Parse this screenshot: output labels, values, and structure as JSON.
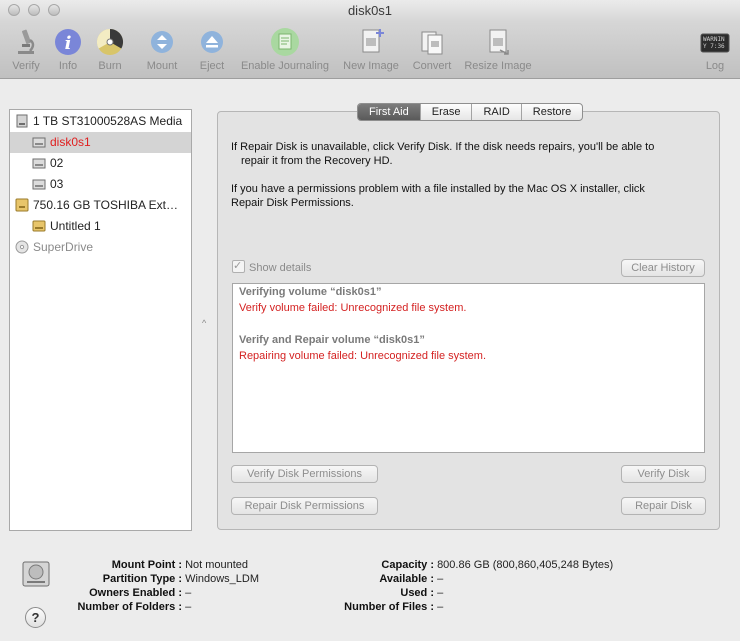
{
  "window": {
    "title": "disk0s1"
  },
  "toolbar": {
    "verify": "Verify",
    "info": "Info",
    "burn": "Burn",
    "mount": "Mount",
    "eject": "Eject",
    "enable_journaling": "Enable Journaling",
    "new_image": "New Image",
    "convert": "Convert",
    "resize_image": "Resize Image",
    "log": "Log",
    "log_icon_text_1": "WARNIN",
    "log_icon_text_2": "Y 7:36"
  },
  "sidebar": {
    "items": [
      {
        "label": "1 TB ST31000528AS Media",
        "selected": false
      },
      {
        "label": "disk0s1",
        "selected": true
      },
      {
        "label": "02",
        "selected": false
      },
      {
        "label": "03",
        "selected": false
      },
      {
        "label": "750.16 GB TOSHIBA Ext…",
        "selected": false
      },
      {
        "label": "Untitled 1",
        "selected": false
      },
      {
        "label": "SuperDrive",
        "selected": false
      }
    ]
  },
  "tabs": [
    "First Aid",
    "Erase",
    "RAID",
    "Restore"
  ],
  "active_tab": "First Aid",
  "first_aid": {
    "para1_line1": "If Repair Disk is unavailable, click Verify Disk. If the disk needs repairs, you'll be able to",
    "para1_line2": "repair it from the Recovery HD.",
    "para2_line1": "If you have a permissions problem with a file installed by the Mac OS X installer, click",
    "para2_line2": "Repair Disk Permissions.",
    "show_details": "Show details",
    "clear_history": "Clear History",
    "log": {
      "h1": "Verifying volume “disk0s1”",
      "e1": "Verify volume failed: Unrecognized file system.",
      "h2": "Verify and Repair volume “disk0s1”",
      "e2": "Repairing volume failed: Unrecognized file system."
    },
    "verify_permissions": "Verify Disk Permissions",
    "verify_disk": "Verify Disk",
    "repair_permissions": "Repair Disk Permissions",
    "repair_disk": "Repair Disk"
  },
  "info": {
    "mount_point_k": "Mount Point :",
    "mount_point_v": "Not mounted",
    "partition_type_k": "Partition Type :",
    "partition_type_v": "Windows_LDM",
    "owners_enabled_k": "Owners Enabled :",
    "owners_enabled_v": "–",
    "folders_k": "Number of Folders :",
    "folders_v": "–",
    "capacity_k": "Capacity :",
    "capacity_v": "800.86 GB (800,860,405,248 Bytes)",
    "available_k": "Available :",
    "available_v": "–",
    "used_k": "Used :",
    "used_v": "–",
    "files_k": "Number of Files :",
    "files_v": "–"
  },
  "help": "?",
  "colors": {
    "error_red": "#d42222",
    "selected_red": "#e02020",
    "info_blue": "#7a86d8"
  }
}
